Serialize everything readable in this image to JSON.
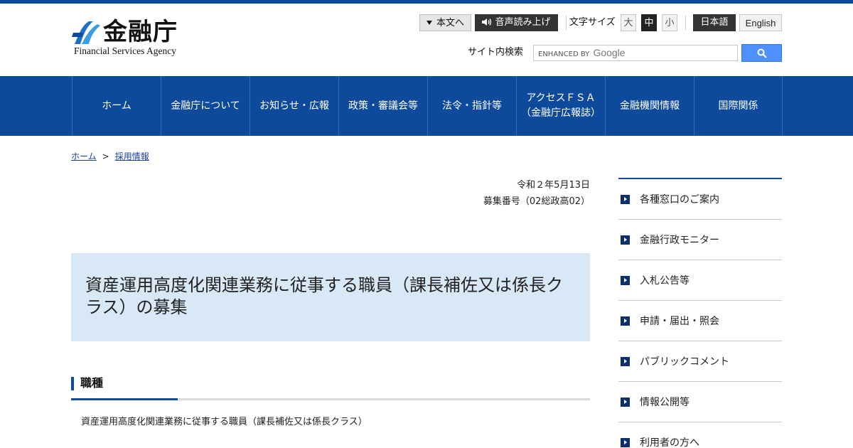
{
  "header": {
    "logo_name": "金融庁",
    "logo_en": "Financial Services Agency",
    "skip_label": "本文へ",
    "voice_label": "音声読み上げ",
    "font_size_label": "文字サイズ",
    "font_sizes": [
      "大",
      "中",
      "小"
    ],
    "lang_ja": "日本語",
    "lang_en": "English",
    "search_label": "サイト内検索",
    "search_placeholder_prefix": "ENHANCED BY",
    "search_placeholder_brand": "Google"
  },
  "nav": [
    {
      "line1": "ホーム",
      "line2": ""
    },
    {
      "line1": "金融庁について",
      "line2": ""
    },
    {
      "line1": "お知らせ・広報",
      "line2": ""
    },
    {
      "line1": "政策・審議会等",
      "line2": ""
    },
    {
      "line1": "法令・指針等",
      "line2": ""
    },
    {
      "line1": "アクセスＦＳＡ",
      "line2": "（金融庁広報誌）"
    },
    {
      "line1": "金融機関情報",
      "line2": ""
    },
    {
      "line1": "国際関係",
      "line2": ""
    }
  ],
  "breadcrumb": {
    "home": "ホーム",
    "separator": ">",
    "current": "採用情報"
  },
  "main": {
    "date": "令和２年5月13日",
    "recruit_no": "募集番号（02総政高02）",
    "title": "資産運用高度化関連業務に従事する職員（課長補佐又は係長クラス）の募集",
    "section_heading": "職種",
    "section_text": "資産運用高度化関連業務に従事する職員（課長補佐又は係長クラス）"
  },
  "sidebar": {
    "items": [
      "各種窓口のご案内",
      "金融行政モニター",
      "入札公告等",
      "申請・届出・照会",
      "パブリックコメント",
      "情報公開等",
      "利用者の方へ"
    ]
  },
  "colors": {
    "brand_blue": "#0d4a9b",
    "title_bg": "#d9e8f7",
    "search_button": "#4d90fe"
  }
}
